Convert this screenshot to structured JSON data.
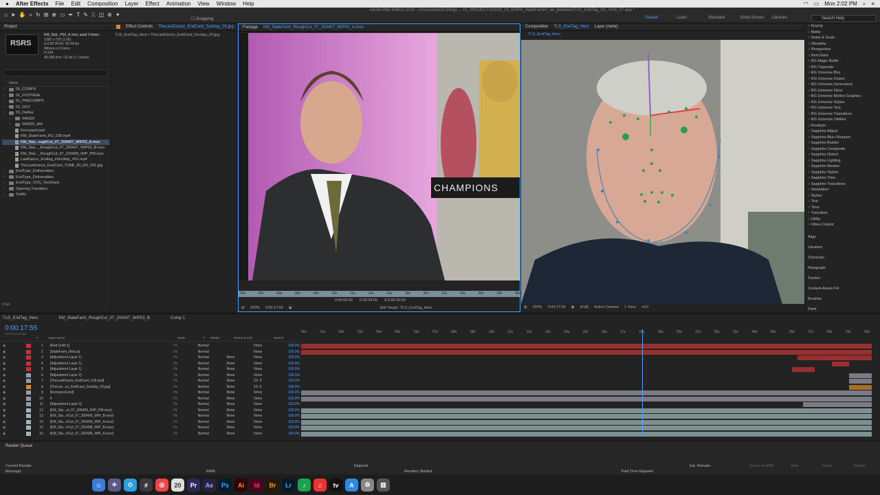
{
  "menubar": {
    "app": "After Effects",
    "items": [
      "File",
      "Edit",
      "Composition",
      "Layer",
      "Effect",
      "Animation",
      "View",
      "Window",
      "Help"
    ],
    "clock": "Mon 2:02 PM"
  },
  "toolbar": {
    "snapping": "Snapping",
    "doc_title": "Adobe After Effects 2020 - /Users/erwin/Collings ... 01_PROJECTS/2020_03_ESPN_StateFarm/0_ae_premiere/TLD_EndTag_SC_VHS_07.aep *",
    "workspaces": [
      "Default",
      "Learn",
      "Standard",
      "Small Screen",
      "Libraries"
    ],
    "search_placeholder": "Search Help"
  },
  "project": {
    "tab": "Project",
    "thumb_label": "RSRS",
    "file_name": "KM_Stat...P02_A.mov",
    "used": ", used 3 times",
    "info": [
      "1280 x 720 (1.00)",
      "Δ 0:00:30:00, 59.94 fps",
      "Millions of Colors",
      "H.264",
      "48.000 kHz / 32 bit U / Stereo"
    ],
    "column": "Name",
    "rows": [
      {
        "name": "00_COMPS",
        "type": "folder",
        "indent": 0
      },
      {
        "name": "01_FOOTAGE",
        "type": "folder",
        "indent": 0
      },
      {
        "name": "01_PRECOMPS",
        "type": "folder",
        "indent": 0
      },
      {
        "name": "02_GFX",
        "type": "folder",
        "indent": 0
      },
      {
        "name": "03_Dailies",
        "type": "folder",
        "indent": 0
      },
      {
        "name": "040320",
        "type": "folder",
        "indent": 1
      },
      {
        "name": "040920_AM",
        "type": "folder",
        "indent": 1
      },
      {
        "name": "Kennypsd.psd",
        "type": "file",
        "indent": 1
      },
      {
        "name": "KM_StateFarm_RC_038.mp4",
        "type": "file",
        "indent": 1
      },
      {
        "name": "KM_Stat...oughCut_07_200407_WIP02_A.mov",
        "type": "file",
        "indent": 1,
        "selected": true
      },
      {
        "name": "KM_Stat..._RoughCut_07_200407_WIP02_B.mov",
        "type": "file",
        "indent": 1
      },
      {
        "name": "KM_Stat..._RoughCut_07_200409_WIP_PM.mov",
        "type": "file",
        "indent": 1
      },
      {
        "name": "LastDance_Endtag_FilmStrip_V01.mp4",
        "type": "file",
        "indent": 1
      },
      {
        "name": "TheLastDance_EndCard_TUNE_IN_DD_001.jpg",
        "type": "file",
        "indent": 1
      },
      {
        "name": "EndType_Deliverables",
        "type": "folder",
        "indent": 0
      },
      {
        "name": "EndType_Deliverables",
        "type": "folder",
        "indent": 0
      },
      {
        "name": "EndType_VOS_TwoStack",
        "type": "folder",
        "indent": 0
      },
      {
        "name": "Opening Transition",
        "type": "folder",
        "indent": 0
      },
      {
        "name": "Solids",
        "type": "folder",
        "indent": 0
      }
    ],
    "bpc": "8 bpc"
  },
  "effect": {
    "tab": "Effect Controls",
    "file": "TheLastDance_EndCard_Sunday_03.jpg",
    "crumb": "TLD_EndTag_Hero • TheLastDance_EndCard_Sunday_03.jpg"
  },
  "footage": {
    "tab": "Footage",
    "file": "KM_StateFarm_RoughCut_07_200407_WIP02_A.mov",
    "ticks": [
      "00s",
      "02s",
      "04s",
      "06s",
      "08s",
      "10s",
      "12s",
      "14s",
      "16s",
      "18s",
      "20s",
      "22s",
      "24s",
      "26s",
      "28s",
      "30s"
    ],
    "zoom": "200%",
    "time": "0:00:17:55",
    "in": "0:00:00:00",
    "out": "0:00:29:59",
    "dur": "Δ 0:00:30:00",
    "edit_target": "Edit Target: TLD_EndTag_Hero",
    "offset": "+0.0",
    "overlay": "CHAMPIONS"
  },
  "composition": {
    "tab": "Composition",
    "name": "TLD_EndTag_Hero",
    "layer": "Layer (none)",
    "subtab": "TLD_EndTag_Hero",
    "zoom": "200%",
    "time": "0:00:17:55",
    "res": "(Full)",
    "camera": "Active Camera",
    "view": "1 View",
    "offset": "+0.0"
  },
  "effects_list": [
    "Keying",
    "Matte",
    "Noise & Grain",
    "Obsolete",
    "Perspective",
    "Red Giant",
    "RG Magic Bullet",
    "RG Trapcode",
    "RG Universe Blur",
    "RG Universe Distort",
    "RG Universe Generators",
    "RG Universe Glow",
    "RG Universe Motion Graphics",
    "RG Universe Stylize",
    "RG Universe Text",
    "RG Universe Transitions",
    "RG Universe Utilities",
    "Rowbyte",
    "Sapphire Adjust",
    "Sapphire Blur+Sharpen",
    "Sapphire Builder",
    "Sapphire Composite",
    "Sapphire Distort",
    "Sapphire Lighting",
    "Sapphire Render",
    "Sapphire Stylize",
    "Sapphire Time",
    "Sapphire Transitions",
    "Simulation",
    "Stylize",
    "Text",
    "Time",
    "Transition",
    "Utility",
    "Video Copilot"
  ],
  "right_sections": [
    "Align",
    "Libraries",
    "Character",
    "Paragraph",
    "Tracker",
    "Content-Aware Fill",
    "Brushes",
    "Paint"
  ],
  "timeline": {
    "tabs": [
      "TLD_EndTag_Hero",
      "KM_StateFarm_RoughCut_07_200407_WIP02_B",
      "Comp 1"
    ],
    "timecode": "0:00:17:55",
    "sub": "01075 (59.94 fps)",
    "headers": [
      "#",
      "Layer Name",
      "Mode",
      "T",
      "TrkMat",
      "Parent & Link",
      "Stretch"
    ],
    "ruler": [
      "00s",
      "01s",
      "02s",
      "03s",
      "04s",
      "05s",
      "06s",
      "07s",
      "08s",
      "09s",
      "10s",
      "11s",
      "12s",
      "13s",
      "14s",
      "15s",
      "16s",
      "17s",
      "18s",
      "19s",
      "20s",
      "21s",
      "22s",
      "23s",
      "24s",
      "25s",
      "26s",
      "27s",
      "28s",
      "29s",
      "30s"
    ],
    "layers": [
      {
        "n": "1",
        "name": "[Red Solid 1]",
        "mode": "Normal",
        "trk": "",
        "parent": "None",
        "stretch": "100.0%",
        "color": "#c23434"
      },
      {
        "n": "2",
        "name": "[StateFarm_Red.ai]",
        "mode": "Normal",
        "trk": "",
        "parent": "None",
        "stretch": "100.0%",
        "color": "#c23434"
      },
      {
        "n": "3",
        "name": "[Adjustment Layer 1]",
        "mode": "Normal",
        "trk": "None",
        "parent": "None",
        "stretch": "100.0%",
        "color": "#c23434"
      },
      {
        "n": "4",
        "name": "[Adjustment Layer 1]",
        "mode": "Normal",
        "trk": "None",
        "parent": "None",
        "stretch": "100.0%",
        "color": "#c23434"
      },
      {
        "n": "5",
        "name": "[Adjustment Layer 1]",
        "mode": "Normal",
        "trk": "None",
        "parent": "None",
        "stretch": "100.0%",
        "color": "#c23434"
      },
      {
        "n": "6",
        "name": "[Adjustment Layer 2]",
        "mode": "Normal",
        "trk": "None",
        "parent": "None",
        "stretch": "100.0%",
        "color": "#9a9aa8"
      },
      {
        "n": "7",
        "name": "[TheLastDance_EndCard_018.psd]",
        "mode": "Normal",
        "trk": "None",
        "parent": "10. 0",
        "stretch": "100.0%",
        "color": "#9a9aa8"
      },
      {
        "n": "8",
        "name": "[TheLas...ce_EndCard_Sunday_03.jpg]",
        "mode": "Normal",
        "trk": "None",
        "parent": "10. 0",
        "stretch": "100.0%",
        "color": "#d68a2a"
      },
      {
        "n": "9",
        "name": "[Kennypsd.psd]",
        "mode": "Normal",
        "trk": "None",
        "parent": "None",
        "stretch": "100.0%",
        "color": "#9a9aa8"
      },
      {
        "n": "10",
        "name": "0",
        "mode": "Normal",
        "trk": "None",
        "parent": "None",
        "stretch": "100.0%",
        "color": "#9a9aa8"
      },
      {
        "n": "11",
        "name": "[Adjustment Layer 3]",
        "mode": "Normal",
        "trk": "None",
        "parent": "None",
        "stretch": "100.0%",
        "color": "#9a9aa8"
      },
      {
        "n": "12",
        "name": "[KM_Sta...ut_07_200409_WIP_PM.mov]",
        "mode": "Normal",
        "trk": "None",
        "parent": "None",
        "stretch": "100.0%",
        "color": "#9fb6b6"
      },
      {
        "n": "13",
        "name": "[KM_Sta...hCut_07_200409_WIP_B.mov]",
        "mode": "Normal",
        "trk": "None",
        "parent": "None",
        "stretch": "100.0%",
        "color": "#9fb6b6"
      },
      {
        "n": "14",
        "name": "[KM_Sta...hCut_07_200409_WIP_A.mov]",
        "mode": "Normal",
        "trk": "None",
        "parent": "None",
        "stretch": "100.0%",
        "color": "#9fb6b6"
      },
      {
        "n": "15",
        "name": "[KM_Sta...hCut_07_200408_WIP_B.mov]",
        "mode": "Normal",
        "trk": "None",
        "parent": "None",
        "stretch": "100.0%",
        "color": "#9fb6b6"
      },
      {
        "n": "16",
        "name": "[KM_Sta...hCut_07_200408_WIP_A.mov]",
        "mode": "Normal",
        "trk": "None",
        "parent": "None",
        "stretch": "100.0%",
        "color": "#9fb6b6"
      }
    ]
  },
  "render": {
    "tab": "Render Queue",
    "current": "Current Render",
    "message": "Message:",
    "ram": "RAM:",
    "started": "Renders Started:",
    "elapsed": "Elapsed:",
    "total": "Total Time Elapsed:",
    "remain": "Est. Remain:",
    "queue_ame": "Queue in AME",
    "stop": "Stop",
    "pause": "Pause",
    "render": "Render"
  },
  "dock": [
    "Ps",
    "Ae",
    "Pr",
    "Ai",
    "Id",
    "Br",
    "Lr"
  ]
}
